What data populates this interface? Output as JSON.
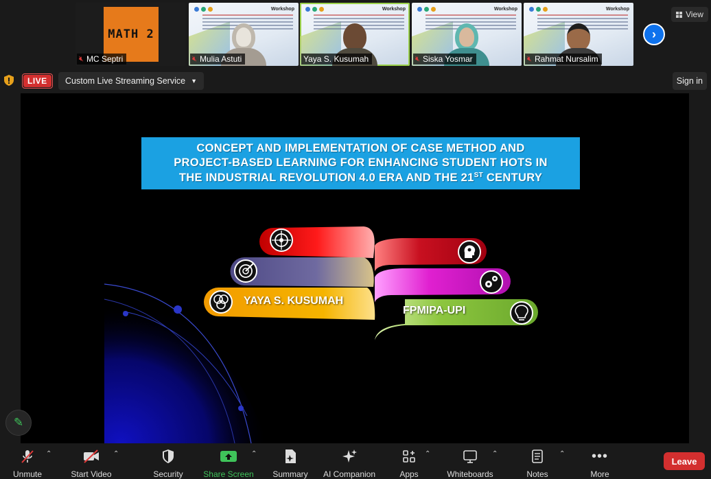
{
  "gallery": {
    "mc": {
      "logo_text": "MATH 2",
      "name": "MC Septri"
    },
    "participants": [
      {
        "name": "Mulia Astuti",
        "active": false
      },
      {
        "name": "Yaya S. Kusumah",
        "active": true
      },
      {
        "name": "Siska Yosmar",
        "active": false
      },
      {
        "name": "Rahmat Nursalim",
        "active": false
      }
    ],
    "mini_slide_heading": "Workshop",
    "view_label": "View"
  },
  "banner": {
    "live_label": "LIVE",
    "stream_label": "Custom Live Streaming Service",
    "signin_label": "Sign in"
  },
  "slide": {
    "title_line1": "CONCEPT AND IMPLEMENTATION OF CASE METHOD AND",
    "title_line2": "PROJECT-BASED LEARNING FOR ENHANCING STUDENT HOTS IN",
    "title_line3a": "THE INDUSTRIAL REVOLUTION 4.0 ERA AND THE 21",
    "title_sup": "ST",
    "title_line3b": " CENTURY",
    "presenter_label": "YAYA S. KUSUMAH",
    "institution_label": "FPMIPA-UPI",
    "colors": {
      "title_bg": "#1ba1e2",
      "ribbon_red": "#ee1111",
      "ribbon_purple": "#6f6aa0",
      "ribbon_yellow": "#f5b400",
      "ribbon_darkred": "#c81020",
      "ribbon_magenta": "#e020d0",
      "ribbon_green": "#8dc63f"
    }
  },
  "toolbar": {
    "unmute": "Unmute",
    "start_video": "Start Video",
    "security": "Security",
    "share_screen": "Share Screen",
    "summary": "Summary",
    "ai_companion": "AI Companion",
    "apps": "Apps",
    "whiteboards": "Whiteboards",
    "notes": "Notes",
    "more": "More",
    "leave": "Leave",
    "share_color": "#3fc35a",
    "leave_color": "#d32f2f"
  }
}
